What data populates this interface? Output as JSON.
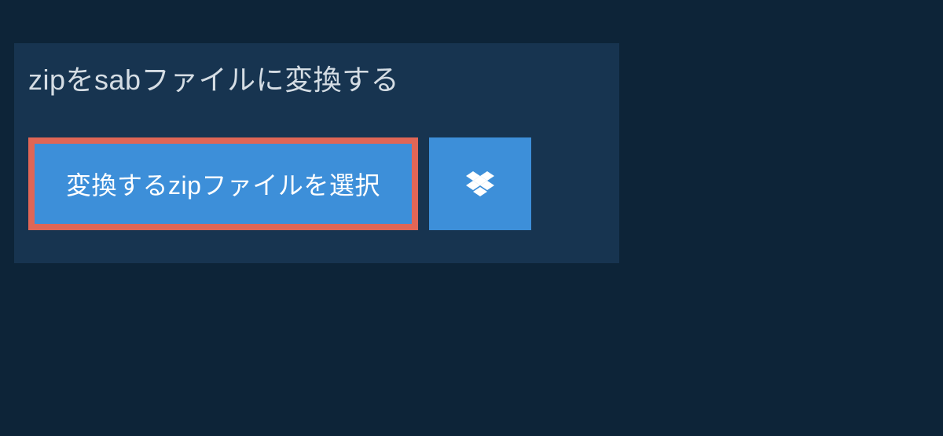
{
  "header": {
    "title": "zipをsabファイルに変換する"
  },
  "actions": {
    "select_file_label": "変換するzipファイルを選択",
    "dropbox_icon_name": "dropbox-icon"
  },
  "colors": {
    "page_bg": "#0d2438",
    "panel_bg": "#173450",
    "button_bg": "#3d8fd9",
    "highlight_border": "#e06656",
    "text_light": "#d5dde4",
    "text_white": "#ffffff"
  }
}
